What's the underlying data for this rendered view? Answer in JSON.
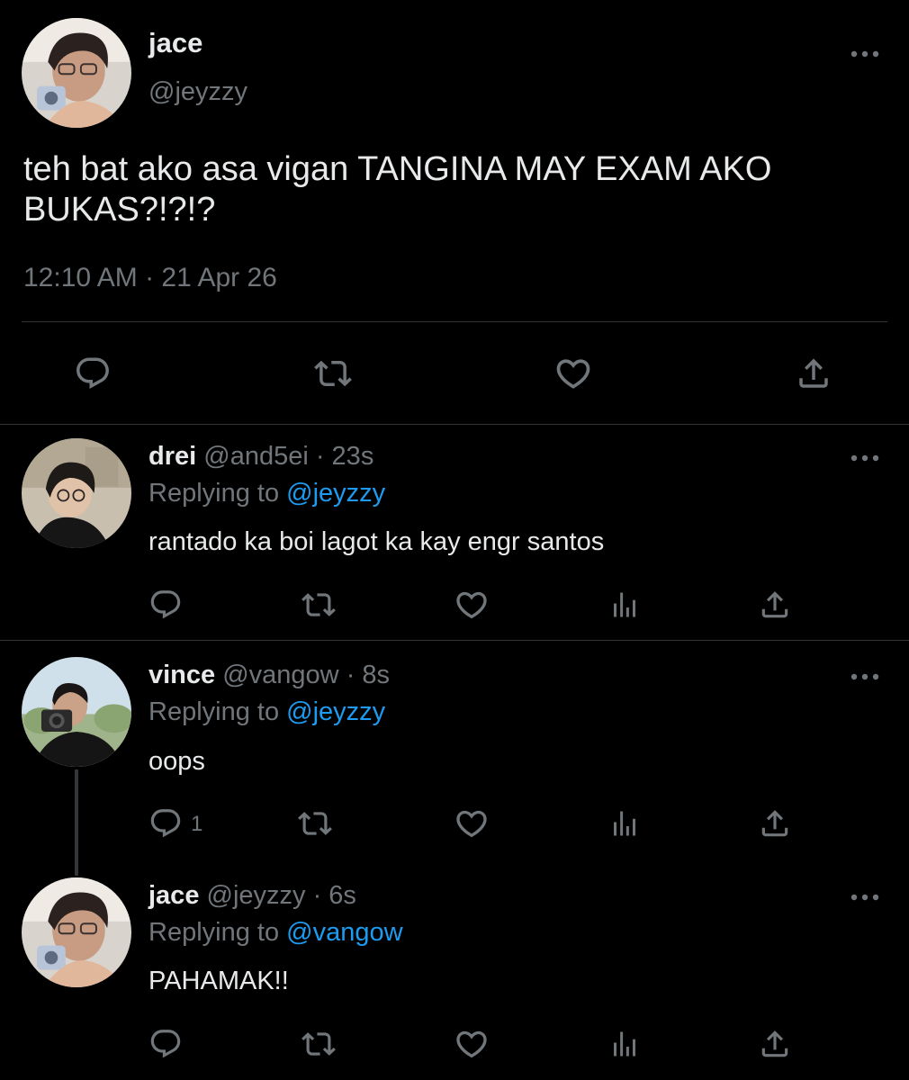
{
  "main_tweet": {
    "name": "jace",
    "handle": "@jeyzzy",
    "text": "teh bat ako asa vigan TANGINA MAY EXAM AKO BUKAS?!?!?",
    "timestamp": "12:10 AM · 21 Apr 26",
    "actions": [
      "reply-icon",
      "retweet-icon",
      "like-icon",
      "share-icon"
    ]
  },
  "replies": [
    {
      "name": "drei",
      "handle": "@and5ei",
      "time": "· 23s",
      "replying_prefix": "Replying to ",
      "replying_to": "@jeyzzy",
      "text": "rantado ka boi lagot ka kay engr santos",
      "reply_count": ""
    },
    {
      "name": "vince",
      "handle": "@vangow",
      "time": "· 8s",
      "replying_prefix": "Replying to ",
      "replying_to": "@jeyzzy",
      "text": "oops",
      "reply_count": "1"
    },
    {
      "name": "jace",
      "handle": "@jeyzzy",
      "time": "· 6s",
      "replying_prefix": "Replying to ",
      "replying_to": "@vangow",
      "text": "PAHAMAK!!",
      "reply_count": ""
    }
  ],
  "colors": {
    "background": "#000000",
    "text": "#e7e9ea",
    "secondary": "#71767b",
    "accent": "#1d9bf0",
    "divider": "#2f3336"
  }
}
